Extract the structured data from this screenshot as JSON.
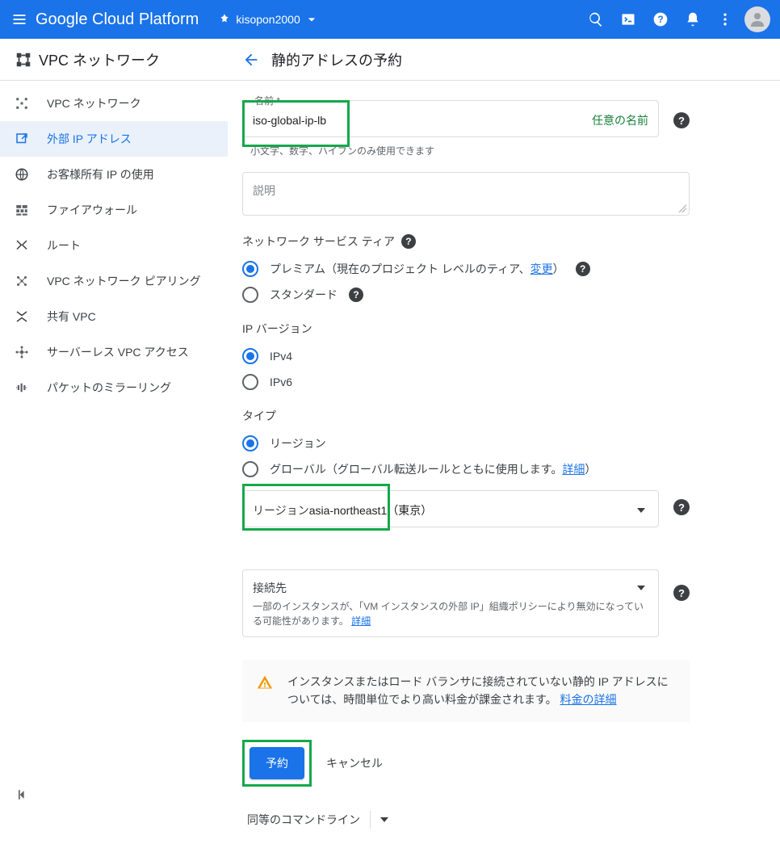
{
  "header": {
    "platform": "Google Cloud Platform",
    "project": "kisopon2000"
  },
  "section": {
    "title": "VPC ネットワーク"
  },
  "sidebar": {
    "items": [
      {
        "label": "VPC ネットワーク",
        "icon": "vpc-icon"
      },
      {
        "label": "外部 IP アドレス",
        "icon": "external-ip-icon"
      },
      {
        "label": "お客様所有 IP の使用",
        "icon": "byoip-icon"
      },
      {
        "label": "ファイアウォール",
        "icon": "firewall-icon"
      },
      {
        "label": "ルート",
        "icon": "routes-icon"
      },
      {
        "label": "VPC ネットワーク ピアリング",
        "icon": "peering-icon"
      },
      {
        "label": "共有 VPC",
        "icon": "shared-vpc-icon"
      },
      {
        "label": "サーバーレス VPC アクセス",
        "icon": "serverless-icon"
      },
      {
        "label": "パケットのミラーリング",
        "icon": "mirror-icon"
      }
    ]
  },
  "page": {
    "title": "静的アドレスの予約"
  },
  "form": {
    "name": {
      "legend": "名前 *",
      "value": "iso-global-ip-lb",
      "side_note": "任意の名前",
      "hint": "小文字、数字、ハイフンのみ使用できます"
    },
    "description": {
      "placeholder": "説明"
    },
    "tier": {
      "label": "ネットワーク サービス ティア",
      "premium": {
        "label_pre": "プレミアム（現在のプロジェクト レベルのティア、",
        "link": "変更",
        "label_post": "）"
      },
      "standard": {
        "label": "スタンダード"
      }
    },
    "ipver": {
      "label": "IP バージョン",
      "v4": "IPv4",
      "v6": "IPv6"
    },
    "type": {
      "label": "タイプ",
      "region": "リージョン",
      "global_pre": "グローバル（グローバル転送ルールとともに使用します。",
      "global_link": "詳細",
      "global_post": "）"
    },
    "region": {
      "legend": "リージョン",
      "value": "asia-northeast1（東京）"
    },
    "attach": {
      "label": "接続先",
      "sub": "一部のインスタンスが、「VM インスタンスの外部 IP」組織ポリシーにより無効になっている可能性があります。",
      "link": "詳細"
    },
    "warning": {
      "text": "インスタンスまたはロード バランサに接続されていない静的 IP アドレスについては、時間単位でより高い料金が課金されます。",
      "link": "料金の詳細"
    },
    "actions": {
      "reserve": "予約",
      "cancel": "キャンセル"
    },
    "equivalent": "同等のコマンドライン"
  }
}
